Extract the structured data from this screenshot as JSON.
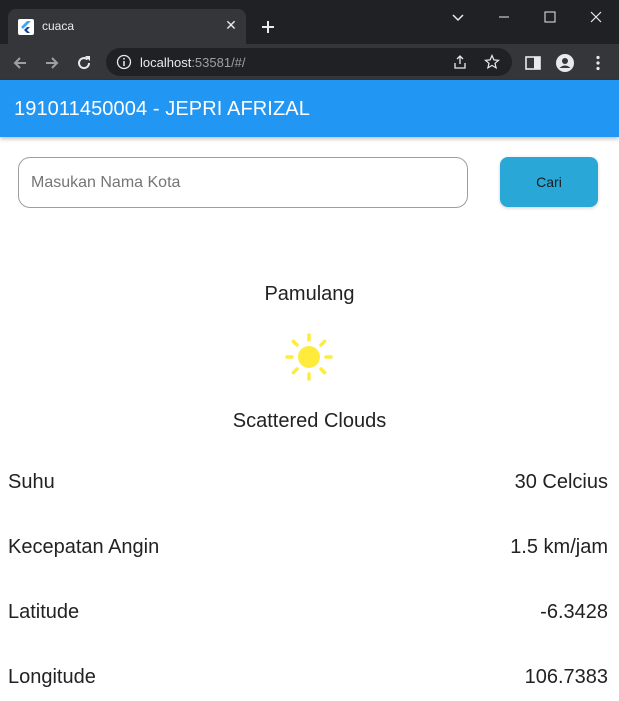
{
  "browser": {
    "tab_title": "cuaca",
    "url_host": "localhost",
    "url_rest": ":53581/#/"
  },
  "appbar": {
    "title": "191011450004 - JEPRI AFRIZAL",
    "color": "#2196f3"
  },
  "search": {
    "placeholder": "Masukan Nama Kota",
    "value": "",
    "button_label": "Cari"
  },
  "weather": {
    "city": "Pamulang",
    "icon": "sun-icon",
    "description": "Scattered Clouds",
    "rows": [
      {
        "label": "Suhu",
        "value": "30 Celcius"
      },
      {
        "label": "Kecepatan Angin",
        "value": "1.5 km/jam"
      },
      {
        "label": "Latitude",
        "value": "-6.3428"
      },
      {
        "label": "Longitude",
        "value": "106.7383"
      }
    ]
  }
}
